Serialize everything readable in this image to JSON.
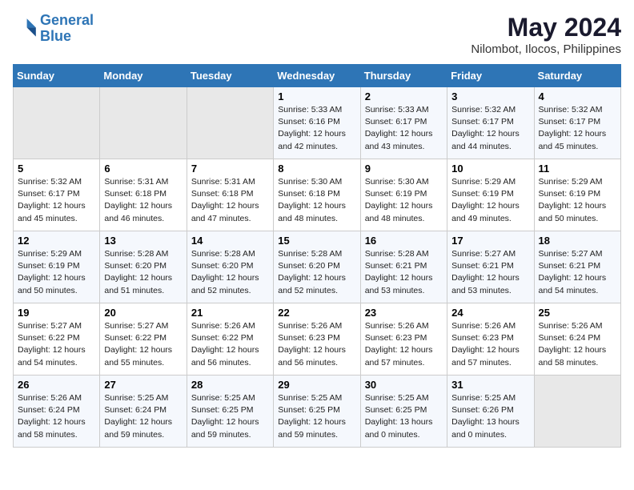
{
  "header": {
    "logo_line1": "General",
    "logo_line2": "Blue",
    "month_year": "May 2024",
    "location": "Nilombot, Ilocos, Philippines"
  },
  "weekdays": [
    "Sunday",
    "Monday",
    "Tuesday",
    "Wednesday",
    "Thursday",
    "Friday",
    "Saturday"
  ],
  "weeks": [
    [
      {
        "day": "",
        "sunrise": "",
        "sunset": "",
        "daylight": ""
      },
      {
        "day": "",
        "sunrise": "",
        "sunset": "",
        "daylight": ""
      },
      {
        "day": "",
        "sunrise": "",
        "sunset": "",
        "daylight": ""
      },
      {
        "day": "1",
        "sunrise": "Sunrise: 5:33 AM",
        "sunset": "Sunset: 6:16 PM",
        "daylight": "Daylight: 12 hours and 42 minutes."
      },
      {
        "day": "2",
        "sunrise": "Sunrise: 5:33 AM",
        "sunset": "Sunset: 6:17 PM",
        "daylight": "Daylight: 12 hours and 43 minutes."
      },
      {
        "day": "3",
        "sunrise": "Sunrise: 5:32 AM",
        "sunset": "Sunset: 6:17 PM",
        "daylight": "Daylight: 12 hours and 44 minutes."
      },
      {
        "day": "4",
        "sunrise": "Sunrise: 5:32 AM",
        "sunset": "Sunset: 6:17 PM",
        "daylight": "Daylight: 12 hours and 45 minutes."
      }
    ],
    [
      {
        "day": "5",
        "sunrise": "Sunrise: 5:32 AM",
        "sunset": "Sunset: 6:17 PM",
        "daylight": "Daylight: 12 hours and 45 minutes."
      },
      {
        "day": "6",
        "sunrise": "Sunrise: 5:31 AM",
        "sunset": "Sunset: 6:18 PM",
        "daylight": "Daylight: 12 hours and 46 minutes."
      },
      {
        "day": "7",
        "sunrise": "Sunrise: 5:31 AM",
        "sunset": "Sunset: 6:18 PM",
        "daylight": "Daylight: 12 hours and 47 minutes."
      },
      {
        "day": "8",
        "sunrise": "Sunrise: 5:30 AM",
        "sunset": "Sunset: 6:18 PM",
        "daylight": "Daylight: 12 hours and 48 minutes."
      },
      {
        "day": "9",
        "sunrise": "Sunrise: 5:30 AM",
        "sunset": "Sunset: 6:19 PM",
        "daylight": "Daylight: 12 hours and 48 minutes."
      },
      {
        "day": "10",
        "sunrise": "Sunrise: 5:29 AM",
        "sunset": "Sunset: 6:19 PM",
        "daylight": "Daylight: 12 hours and 49 minutes."
      },
      {
        "day": "11",
        "sunrise": "Sunrise: 5:29 AM",
        "sunset": "Sunset: 6:19 PM",
        "daylight": "Daylight: 12 hours and 50 minutes."
      }
    ],
    [
      {
        "day": "12",
        "sunrise": "Sunrise: 5:29 AM",
        "sunset": "Sunset: 6:19 PM",
        "daylight": "Daylight: 12 hours and 50 minutes."
      },
      {
        "day": "13",
        "sunrise": "Sunrise: 5:28 AM",
        "sunset": "Sunset: 6:20 PM",
        "daylight": "Daylight: 12 hours and 51 minutes."
      },
      {
        "day": "14",
        "sunrise": "Sunrise: 5:28 AM",
        "sunset": "Sunset: 6:20 PM",
        "daylight": "Daylight: 12 hours and 52 minutes."
      },
      {
        "day": "15",
        "sunrise": "Sunrise: 5:28 AM",
        "sunset": "Sunset: 6:20 PM",
        "daylight": "Daylight: 12 hours and 52 minutes."
      },
      {
        "day": "16",
        "sunrise": "Sunrise: 5:28 AM",
        "sunset": "Sunset: 6:21 PM",
        "daylight": "Daylight: 12 hours and 53 minutes."
      },
      {
        "day": "17",
        "sunrise": "Sunrise: 5:27 AM",
        "sunset": "Sunset: 6:21 PM",
        "daylight": "Daylight: 12 hours and 53 minutes."
      },
      {
        "day": "18",
        "sunrise": "Sunrise: 5:27 AM",
        "sunset": "Sunset: 6:21 PM",
        "daylight": "Daylight: 12 hours and 54 minutes."
      }
    ],
    [
      {
        "day": "19",
        "sunrise": "Sunrise: 5:27 AM",
        "sunset": "Sunset: 6:22 PM",
        "daylight": "Daylight: 12 hours and 54 minutes."
      },
      {
        "day": "20",
        "sunrise": "Sunrise: 5:27 AM",
        "sunset": "Sunset: 6:22 PM",
        "daylight": "Daylight: 12 hours and 55 minutes."
      },
      {
        "day": "21",
        "sunrise": "Sunrise: 5:26 AM",
        "sunset": "Sunset: 6:22 PM",
        "daylight": "Daylight: 12 hours and 56 minutes."
      },
      {
        "day": "22",
        "sunrise": "Sunrise: 5:26 AM",
        "sunset": "Sunset: 6:23 PM",
        "daylight": "Daylight: 12 hours and 56 minutes."
      },
      {
        "day": "23",
        "sunrise": "Sunrise: 5:26 AM",
        "sunset": "Sunset: 6:23 PM",
        "daylight": "Daylight: 12 hours and 57 minutes."
      },
      {
        "day": "24",
        "sunrise": "Sunrise: 5:26 AM",
        "sunset": "Sunset: 6:23 PM",
        "daylight": "Daylight: 12 hours and 57 minutes."
      },
      {
        "day": "25",
        "sunrise": "Sunrise: 5:26 AM",
        "sunset": "Sunset: 6:24 PM",
        "daylight": "Daylight: 12 hours and 58 minutes."
      }
    ],
    [
      {
        "day": "26",
        "sunrise": "Sunrise: 5:26 AM",
        "sunset": "Sunset: 6:24 PM",
        "daylight": "Daylight: 12 hours and 58 minutes."
      },
      {
        "day": "27",
        "sunrise": "Sunrise: 5:25 AM",
        "sunset": "Sunset: 6:24 PM",
        "daylight": "Daylight: 12 hours and 59 minutes."
      },
      {
        "day": "28",
        "sunrise": "Sunrise: 5:25 AM",
        "sunset": "Sunset: 6:25 PM",
        "daylight": "Daylight: 12 hours and 59 minutes."
      },
      {
        "day": "29",
        "sunrise": "Sunrise: 5:25 AM",
        "sunset": "Sunset: 6:25 PM",
        "daylight": "Daylight: 12 hours and 59 minutes."
      },
      {
        "day": "30",
        "sunrise": "Sunrise: 5:25 AM",
        "sunset": "Sunset: 6:25 PM",
        "daylight": "Daylight: 13 hours and 0 minutes."
      },
      {
        "day": "31",
        "sunrise": "Sunrise: 5:25 AM",
        "sunset": "Sunset: 6:26 PM",
        "daylight": "Daylight: 13 hours and 0 minutes."
      },
      {
        "day": "",
        "sunrise": "",
        "sunset": "",
        "daylight": ""
      }
    ]
  ]
}
